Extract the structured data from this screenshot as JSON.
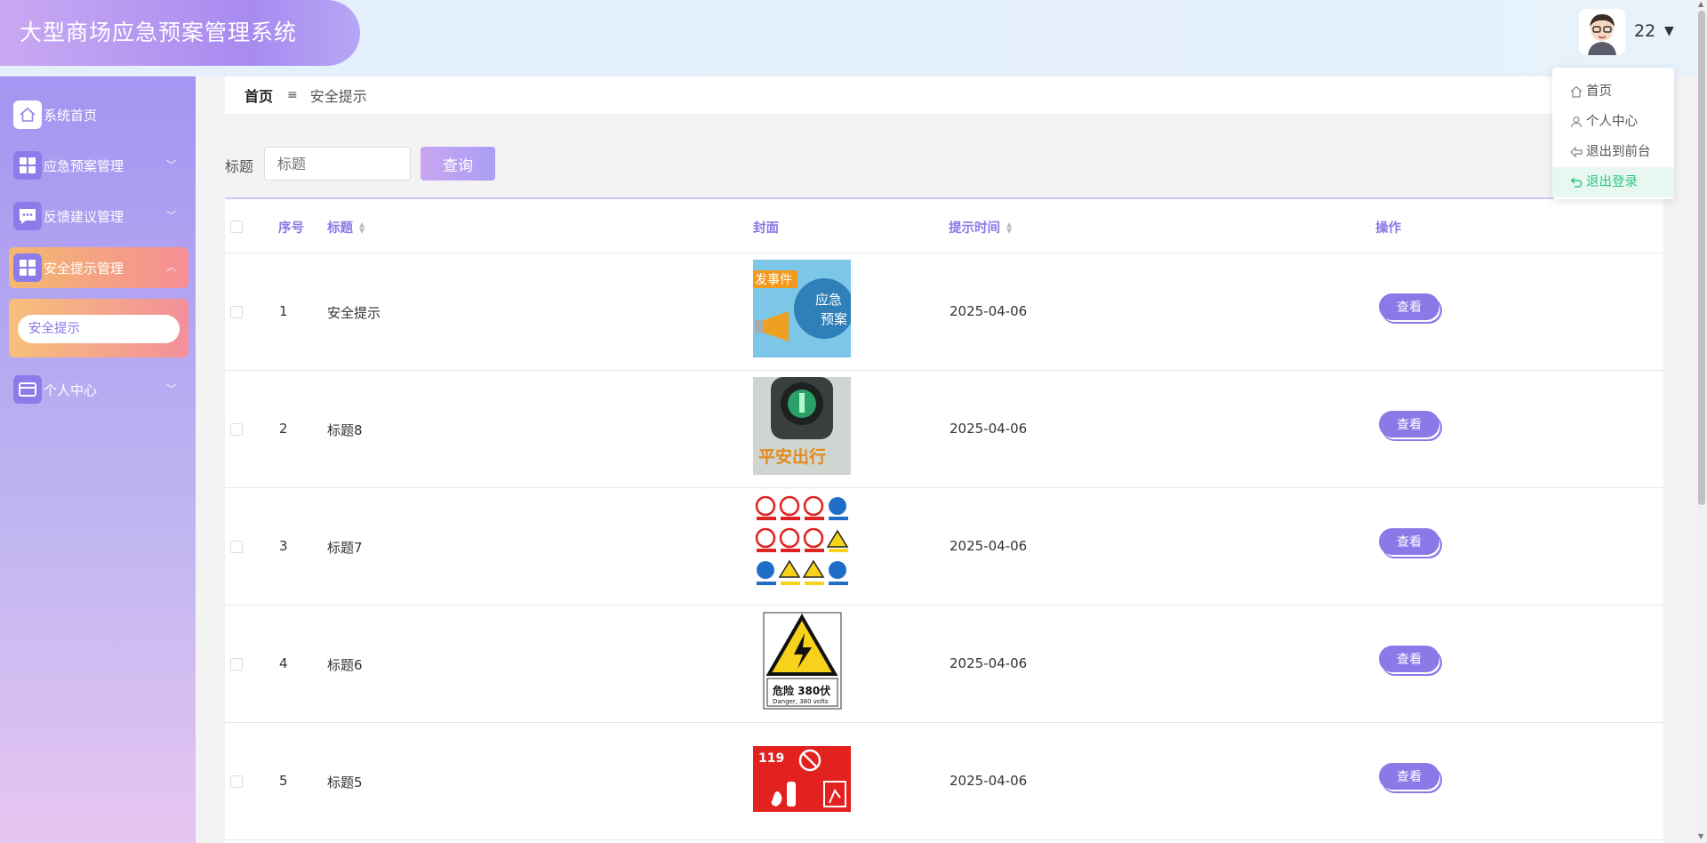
{
  "app": {
    "title": "大型商场应急预案管理系统"
  },
  "user": {
    "name": "22",
    "menu": [
      {
        "label": "首页",
        "icon": "home-icon"
      },
      {
        "label": "个人中心",
        "icon": "user-icon"
      },
      {
        "label": "退出到前台",
        "icon": "back-icon"
      },
      {
        "label": "退出登录",
        "icon": "logout-icon"
      }
    ]
  },
  "sidebar": {
    "items": [
      {
        "label": "系统首页",
        "icon": "home-icon"
      },
      {
        "label": "应急预案管理",
        "icon": "grid-icon"
      },
      {
        "label": "反馈建议管理",
        "icon": "chat-icon"
      },
      {
        "label": "安全提示管理",
        "icon": "grid-icon"
      },
      {
        "label": "个人中心",
        "icon": "card-icon"
      }
    ],
    "sub_item": "安全提示"
  },
  "breadcrumb": {
    "home": "首页",
    "current": "安全提示"
  },
  "search": {
    "label": "标题",
    "placeholder": "标题",
    "button": "查询"
  },
  "table": {
    "columns": {
      "index": "序号",
      "title": "标题",
      "cover": "封面",
      "time": "提示时间",
      "action": "操作"
    },
    "rows": [
      {
        "index": "1",
        "title": "安全提示",
        "time": "2025-04-06",
        "action": "查看",
        "cover_text": "发事件"
      },
      {
        "index": "2",
        "title": "标题8",
        "time": "2025-04-06",
        "action": "查看",
        "cover_text": "平安出行"
      },
      {
        "index": "3",
        "title": "标题7",
        "time": "2025-04-06",
        "action": "查看",
        "cover_text": ""
      },
      {
        "index": "4",
        "title": "标题6",
        "time": "2025-04-06",
        "action": "查看",
        "cover_text": "危险 380伏"
      },
      {
        "index": "5",
        "title": "标题5",
        "time": "2025-04-06",
        "action": "查看",
        "cover_text": "119"
      }
    ]
  },
  "colors": {
    "accent": "#8d78e8",
    "active_menu": "#f4b96e",
    "logout_green": "#2ec489"
  }
}
